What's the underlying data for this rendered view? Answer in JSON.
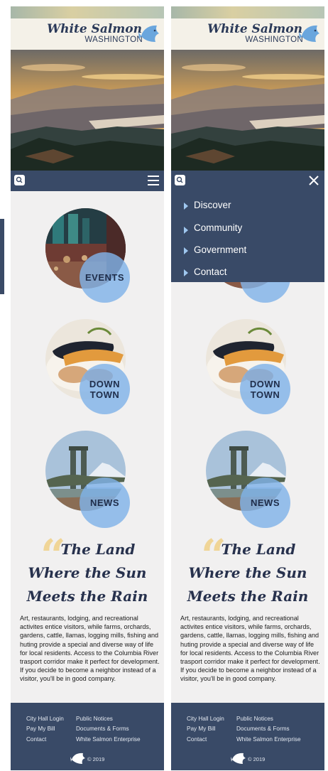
{
  "site": {
    "title": "White Salmon",
    "subtitle": "WASHINGTON"
  },
  "tiles": [
    {
      "label": "EVENTS",
      "icon": "restaurant-photo"
    },
    {
      "label_line1": "DOWN",
      "label_line2": "TOWN",
      "icon": "seafood-photo"
    },
    {
      "label": "NEWS",
      "icon": "bridge-photo"
    }
  ],
  "quote": {
    "mark": "“",
    "line1": "The Land",
    "line2": "Where the Sun",
    "line3": "Meets the Rain"
  },
  "body_text": "Art, restaurants, lodging, and recreational activites entice visitors, while farms, orchards, gardens, cattle, llamas, logging mills, fishing and huting provide a special and diverse way of life for local residents. Access to the Columbia River trasport corridor make it perfect for development. If you decide to become a neighbor instead of a visitor, you'll be in good company.",
  "footer": {
    "left_links": [
      "City Hall Login",
      "Pay My Bill",
      "Contact"
    ],
    "right_links": [
      "Public Notices",
      "Documents & Forms",
      "White Salmon Enterprise"
    ],
    "copyright": "© 2019"
  },
  "menu": {
    "items": [
      "Discover",
      "Community",
      "Government",
      "Contact"
    ]
  },
  "colors": {
    "navy": "#394a67",
    "badge_blue": "#80b2e8",
    "quote_gold": "#f0d597",
    "page_bg": "#f1f0f0"
  }
}
